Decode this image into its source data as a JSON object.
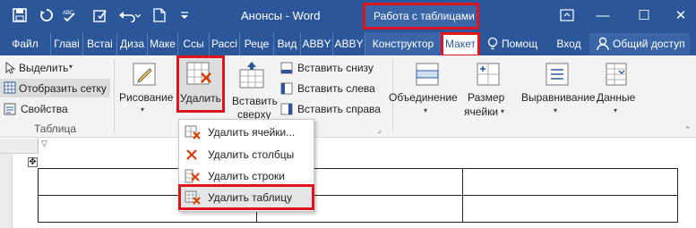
{
  "window": {
    "title": "Анонсы - Word",
    "context_tab_group": "Работа с таблицами",
    "controls": {
      "minimize": "—",
      "maximize": "☐",
      "close": "✕"
    }
  },
  "quick_access": {
    "save_icon": "save-icon",
    "undo_icon": "undo-icon",
    "spelling_icon": "spelling-check-icon",
    "touch_icon": "touch-mode-icon",
    "redo_icon": "redo-icon",
    "new_icon": "new-document-icon",
    "customize_icon": "customize-qat-icon"
  },
  "tabs": {
    "file": "Файл",
    "home": "Главі",
    "insert": "Встаі",
    "design": "Диза",
    "layout": "Маке",
    "references": "Ссы",
    "mailings": "Рассі",
    "review": "Реце",
    "view": "Вид",
    "abbyy1": "ABBY",
    "abbyy2": "ABBY",
    "constructor": "Конструктор",
    "table_layout": "Макет",
    "tell_me": "Помощ",
    "signin": "Вход",
    "share": "Общий доступ"
  },
  "ribbon": {
    "select": "Выделить",
    "show_grid": "Отобразить сетку",
    "properties": "Свойства",
    "group_table": "Таблица",
    "draw": "Рисование",
    "delete": "Удалить",
    "insert_above_1": "Вставить",
    "insert_above_2": "сверху",
    "insert_below": "Вставить снизу",
    "insert_left": "Вставить слева",
    "insert_right": "Вставить справа",
    "merge": "Объединение",
    "cell_size_1": "Размер",
    "cell_size_2": "ячейки",
    "alignment": "Выравнивание",
    "data": "Данные"
  },
  "delete_menu": {
    "items": [
      {
        "label": "Удалить ячейки...",
        "icon": "delete-cells-icon"
      },
      {
        "label": "Удалить столбцы",
        "icon": "delete-columns-icon"
      },
      {
        "label": "Удалить строки",
        "icon": "delete-rows-icon"
      },
      {
        "label": "Удалить таблицу",
        "icon": "delete-table-icon"
      }
    ]
  },
  "colors": {
    "title_bar": "#2b579a",
    "highlight_red": "#e0141e",
    "ribbon_bg": "#f3f3f3",
    "selected_bg": "#dcdcdc"
  }
}
